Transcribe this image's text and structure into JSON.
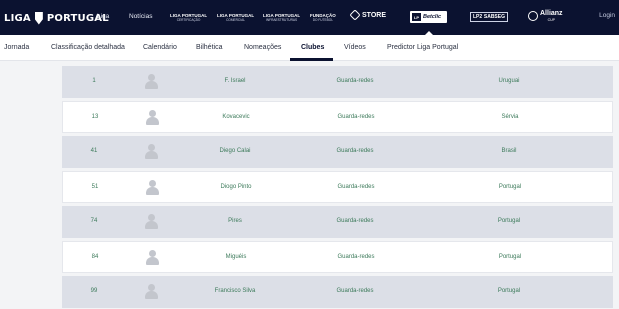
{
  "header": {
    "brand": "LIGA PORTUGAL",
    "brand_left": "LIGA",
    "brand_right": "PORTUGAL",
    "nav": [
      "Liga",
      "Notícias"
    ],
    "sub_logos": [
      {
        "line1": "LIGA PORTUGAL",
        "line2": "CERTIFICAÇÃO"
      },
      {
        "line1": "LIGA PORTUGAL",
        "line2": "COMERCIAL"
      },
      {
        "line1": "LIGA PORTUGAL",
        "line2": "INFRAESTRUTURAS"
      },
      {
        "line1": "FUNDAÇÃO",
        "line2": "DO FUTEBOL"
      }
    ],
    "store_label": "STORE",
    "betclic_lp": "LP",
    "betclic_label": "Betclic",
    "lp2_left": "LP2",
    "lp2_right": "SABSEG",
    "allianz_label": "Allianz",
    "allianz_sub": "CUP",
    "login": "Login"
  },
  "tabs": [
    {
      "label": "Jornada"
    },
    {
      "label": "Classificação detalhada"
    },
    {
      "label": "Calendário"
    },
    {
      "label": "Bilhética"
    },
    {
      "label": "Nomeações"
    },
    {
      "label": "Clubes",
      "active": true
    },
    {
      "label": "Vídeos"
    },
    {
      "label": "Predictor Liga Portugal"
    }
  ],
  "players": [
    {
      "number": "1",
      "name": "F. Israel",
      "position": "Guarda-redes",
      "nationality": "Uruguai"
    },
    {
      "number": "13",
      "name": "Kovacevic",
      "position": "Guarda-redes",
      "nationality": "Sérvia"
    },
    {
      "number": "41",
      "name": "Diego Calai",
      "position": "Guarda-redes",
      "nationality": "Brasil"
    },
    {
      "number": "51",
      "name": "Diogo Pinto",
      "position": "Guarda-redes",
      "nationality": "Portugal"
    },
    {
      "number": "74",
      "name": "Pires",
      "position": "Guarda-redes",
      "nationality": "Portugal"
    },
    {
      "number": "84",
      "name": "Miguéis",
      "position": "Guarda-redes",
      "nationality": "Portugal"
    },
    {
      "number": "99",
      "name": "Francisco Silva",
      "position": "Guarda-redes",
      "nationality": "Portugal"
    }
  ],
  "colors": {
    "header_bg": "#0b1230",
    "row_odd": "#dcdfe7",
    "row_even": "#ffffff",
    "cell_text": "#3c7a5a"
  },
  "icons": {
    "avatar": "user-silhouette-icon",
    "store": "diamond-icon",
    "allianz": "circle-logo-icon"
  }
}
